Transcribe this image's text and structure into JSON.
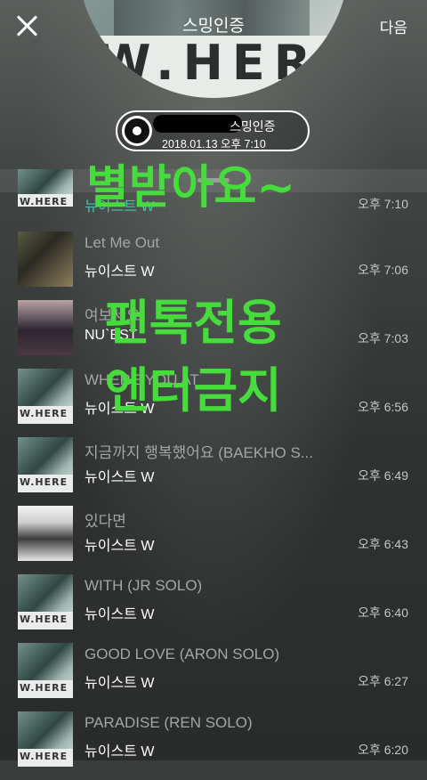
{
  "header": {
    "title": "스밍인증",
    "next_label": "다음",
    "album_text": "W.HER"
  },
  "certification": {
    "label": "스밍인증",
    "datetime": "2018.01.13 오후 7:10"
  },
  "songs": [
    {
      "title": "",
      "artist": "뉴이스트 W",
      "time": "오후 7:10"
    },
    {
      "title": "Let Me Out",
      "artist": "뉴이스트 W",
      "time": "오후 7:06"
    },
    {
      "title": "여보세요",
      "artist": "NU`EST",
      "time": "오후 7:03"
    },
    {
      "title": "WHERE YOU AT",
      "artist": "뉴이스트 W",
      "time": "오후 6:56"
    },
    {
      "title": "지금까지 행복했어요 (BAEKHO S...",
      "artist": "뉴이스트 W",
      "time": "오후 6:49"
    },
    {
      "title": "있다면",
      "artist": "뉴이스트 W",
      "time": "오후 6:43"
    },
    {
      "title": "WITH (JR SOLO)",
      "artist": "뉴이스트 W",
      "time": "오후 6:40"
    },
    {
      "title": "GOOD LOVE (ARON SOLO)",
      "artist": "뉴이스트 W",
      "time": "오후 6:27"
    },
    {
      "title": "PARADISE (REN SOLO)",
      "artist": "뉴이스트 W",
      "time": "오후 6:20"
    }
  ],
  "overlay": {
    "line1": "별받아요~",
    "line2": "팬톡전용",
    "line3": "엔터금지",
    "color": "#46dd3c"
  }
}
